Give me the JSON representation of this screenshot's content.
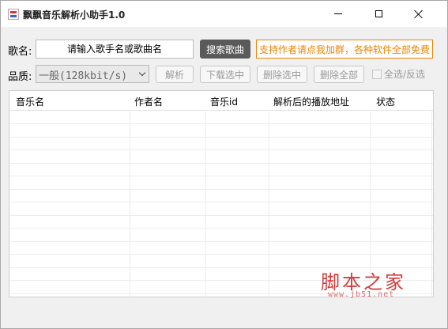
{
  "window": {
    "title": "飘飘音乐解析小助手1.0",
    "controls": {
      "minimize": "minimize-icon",
      "maximize": "maximize-icon",
      "close": "close-icon"
    }
  },
  "search": {
    "label": "歌名:",
    "placeholder": "请输入歌手名或歌曲名",
    "button_label": "搜索歌曲",
    "promo_text": "支持作者请点我加群，各种软件全部免费"
  },
  "quality": {
    "label": "品质:",
    "selected": "一般(128kbit/s)"
  },
  "actions": {
    "parse": "解析",
    "download_selected": "下载选中",
    "delete_selected": "删除选中",
    "delete_all": "删除全部",
    "select_all": "全选/反选"
  },
  "table": {
    "columns": [
      "音乐名",
      "作者名",
      "音乐id",
      "解析后的播放地址",
      "状态"
    ],
    "rows": []
  },
  "watermark": {
    "text": "脚本之家",
    "url": "www.jb51.net"
  },
  "colors": {
    "accent_orange": "#f08300",
    "search_button": "#5a5a5a",
    "watermark": "#d63b3b"
  }
}
